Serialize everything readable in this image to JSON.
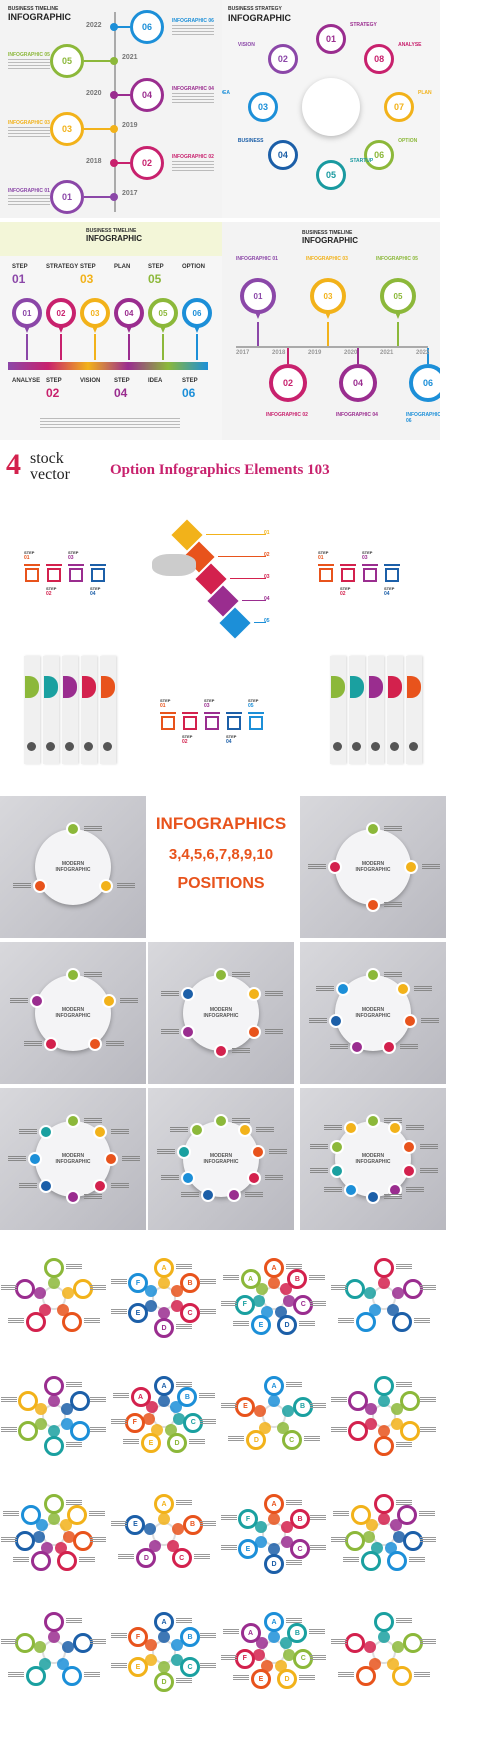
{
  "banner": {
    "logo_number": "4",
    "logo_word1": "stock",
    "logo_word2": "vector",
    "title": "Option Infographics Elements 103"
  },
  "timeline1": {
    "title_line1": "BUSINESS TIMELINE",
    "title_line2": "INFOGRAPHIC",
    "years": [
      "2022",
      "2021",
      "2020",
      "2019",
      "2018",
      "2017"
    ],
    "steps": [
      "06",
      "05",
      "04",
      "03",
      "02",
      "01"
    ],
    "labels": [
      "INFOGRAPHIC 06",
      "INFOGRAPHIC 05",
      "INFOGRAPHIC 04",
      "INFOGRAPHIC 03",
      "INFOGRAPHIC 02",
      "INFOGRAPHIC 01"
    ],
    "colors": [
      "#1c8fd8",
      "#8cb83a",
      "#9a2d8f",
      "#f2b21a",
      "#c8216d",
      "#8b47a8"
    ]
  },
  "strategy": {
    "title_line1": "BUSINESS STRATEGY",
    "title_line2": "INFOGRAPHIC",
    "items": [
      {
        "num": "01",
        "label": "STRATEGY"
      },
      {
        "num": "08",
        "label": "ANALYSE"
      },
      {
        "num": "07",
        "label": "PLAN"
      },
      {
        "num": "06",
        "label": "OPTION"
      },
      {
        "num": "05",
        "label": "STARTUP"
      },
      {
        "num": "04",
        "label": "BUSINESS"
      },
      {
        "num": "03",
        "label": "IDEA"
      },
      {
        "num": "02",
        "label": "VISION"
      }
    ],
    "colors": [
      "#9a2d8f",
      "#c8216d",
      "#f2b21a",
      "#8cb83a",
      "#1a9aa0",
      "#1c5fa8",
      "#1c8fd8",
      "#8b47a8"
    ]
  },
  "steps": {
    "title_line1": "BUSINESS TIMELINE",
    "title_line2": "INFOGRAPHIC",
    "top": [
      {
        "word": "STEP",
        "num": "01"
      },
      {
        "word": "STRATEGY",
        "num": ""
      },
      {
        "word": "STEP",
        "num": "03"
      },
      {
        "word": "PLAN",
        "num": ""
      },
      {
        "word": "STEP",
        "num": "05"
      },
      {
        "word": "OPTION",
        "num": ""
      }
    ],
    "pins": [
      "01",
      "02",
      "03",
      "04",
      "05",
      "06"
    ],
    "bottom": [
      {
        "word": "ANALYSE",
        "num": ""
      },
      {
        "word": "STEP",
        "num": "02"
      },
      {
        "word": "VISION",
        "num": ""
      },
      {
        "word": "STEP",
        "num": "04"
      },
      {
        "word": "IDEA",
        "num": ""
      },
      {
        "word": "STEP",
        "num": "06"
      }
    ],
    "colors": [
      "#8b47a8",
      "#c8216d",
      "#f2b21a",
      "#9a2d8f",
      "#8cb83a",
      "#1c8fd8"
    ]
  },
  "timeline2": {
    "title_line1": "BUSINESS TIMELINE",
    "title_line2": "INFOGRAPHIC",
    "top_labels": [
      "INFOGRAPHIC 01",
      "INFOGRAPHIC 03",
      "INFOGRAPHIC 05"
    ],
    "bottom_labels": [
      "INFOGRAPHIC 02",
      "INFOGRAPHIC 04",
      "INFOGRAPHIC 06"
    ],
    "top_steps": [
      "01",
      "03",
      "05"
    ],
    "bottom_steps": [
      "02",
      "04",
      "06"
    ],
    "years": [
      "2017",
      "2018",
      "2019",
      "2020",
      "2021",
      "2022"
    ],
    "colors": [
      "#8b47a8",
      "#c8216d",
      "#f2b21a",
      "#9a2d8f",
      "#8cb83a",
      "#1c8fd8"
    ]
  },
  "promo": {
    "line1": "INFOGRAPHICS",
    "line2": "3,4,5,6,7,8,9,10",
    "line3": "POSITIONS"
  },
  "modern": {
    "label_line1": "MODERN",
    "label_line2": "INFOGRAPHIC"
  },
  "step_word": "STEP",
  "step_nums": [
    "01",
    "02",
    "03",
    "04",
    "05"
  ],
  "letters": [
    "A",
    "B",
    "C",
    "D",
    "E",
    "F"
  ],
  "palette": [
    "#8cb83a",
    "#f2b21a",
    "#e8531c",
    "#d3214d",
    "#9a2d8f",
    "#1c5fa8",
    "#1c8fd8",
    "#1aa0a0"
  ]
}
